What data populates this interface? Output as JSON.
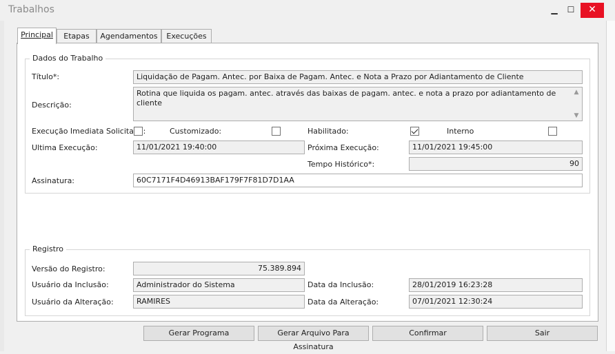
{
  "window": {
    "title": "Trabalhos",
    "min_glyph": "▁",
    "max_glyph": "☐",
    "close_glyph": "✕"
  },
  "tabs": [
    {
      "label": "Principal",
      "active": true
    },
    {
      "label": "Etapas",
      "active": false
    },
    {
      "label": "Agendamentos",
      "active": false
    },
    {
      "label": "Execuções",
      "active": false
    }
  ],
  "dados": {
    "legend": "Dados do Trabalho",
    "titulo_label": "Título*:",
    "titulo_value": "Liquidação de Pagam. Antec. por Baixa de Pagam. Antec. e Nota a Prazo por Adiantamento de Cliente",
    "descricao_label": "Descrição:",
    "descricao_value": "Rotina que liquida os pagam. antec. através das baixas de pagam. antec. e nota a prazo por adiantamento de cliente",
    "exec_imediata_label": "Execução Imediata Solicitada:",
    "exec_imediata_checked": false,
    "customizado_label": "Customizado:",
    "customizado_checked": false,
    "habilitado_label": "Habilitado:",
    "habilitado_checked": true,
    "interno_label": "Interno",
    "interno_checked": false,
    "ultima_exec_label": "Ultima Execução:",
    "ultima_exec_value": "11/01/2021 19:40:00",
    "proxima_exec_label": "Próxima Execução:",
    "proxima_exec_value": "11/01/2021 19:45:00",
    "tempo_hist_label": "Tempo Histórico*:",
    "tempo_hist_value": "90",
    "assinatura_label": "Assinatura:",
    "assinatura_value": "60C7171F4D46913BAF179F7F81D7D1AA"
  },
  "registro": {
    "legend": "Registro",
    "versao_label": "Versão do Registro:",
    "versao_value": "75.389.894",
    "usuario_inclusao_label": "Usuário da Inclusão:",
    "usuario_inclusao_value": "Administrador do Sistema",
    "data_inclusao_label": "Data da Inclusão:",
    "data_inclusao_value": "28/01/2019 16:23:28",
    "usuario_alteracao_label": "Usuário da Alteração:",
    "usuario_alteracao_value": "RAMIRES",
    "data_alteracao_label": "Data da Alteração:",
    "data_alteracao_value": "07/01/2021 12:30:24"
  },
  "buttons": {
    "gerar_programa": "Gerar Programa",
    "gerar_arquivo": "Gerar Arquivo Para Assinatura",
    "confirmar": "Confirmar",
    "sair": "Sair"
  },
  "scroll": {
    "up": "▲",
    "down": "▼"
  },
  "colors": {
    "close_button": "#e81123",
    "panel_bg": "#ffffff",
    "field_bg": "#f0f0f0"
  }
}
